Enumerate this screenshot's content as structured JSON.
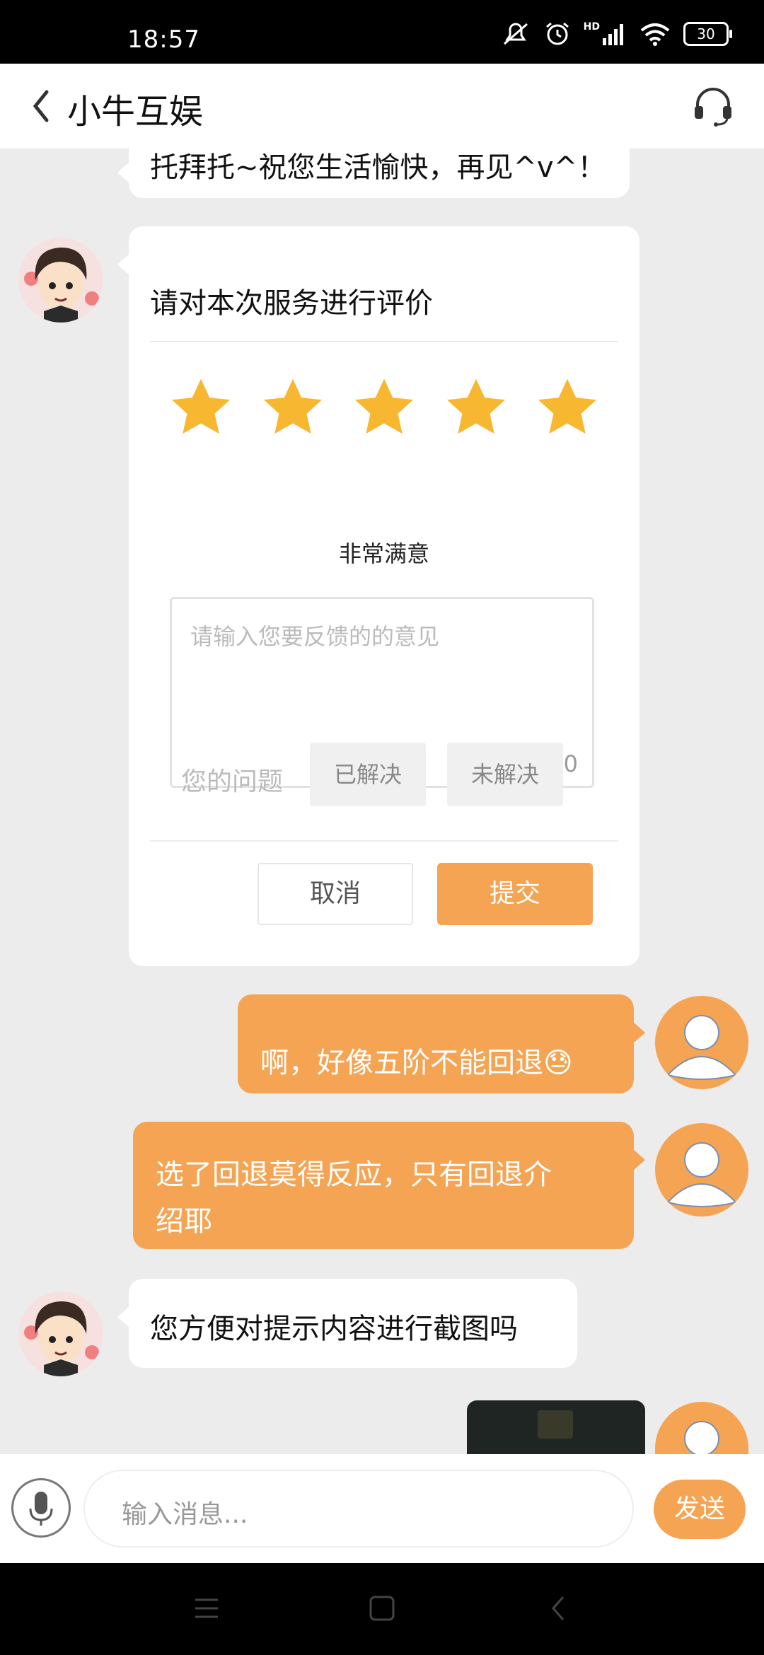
{
  "status_bar": {
    "time": "18:57",
    "network": "HD",
    "battery": "30"
  },
  "header": {
    "title": "小牛互娱",
    "back_icon": "chevron-left-icon",
    "support_icon": "headset-icon"
  },
  "messages": [
    {
      "side": "service",
      "text": "托拜托~祝您生活愉快，再见^v^！"
    },
    {
      "side": "user",
      "text": "啊，好像五阶不能回退😓"
    },
    {
      "side": "user",
      "text_line1": "选了回退莫得反应，只有回退介",
      "text_line2": "绍耶"
    },
    {
      "side": "service",
      "text": "您方便对提示内容进行截图吗"
    }
  ],
  "rating_card": {
    "title": "请对本次服务进行评价",
    "stars": 5,
    "max_stars": 5,
    "rating_label": "非常满意",
    "feedback_placeholder": "请输入您要反馈的的意见",
    "feedback_count": "0/200",
    "issue_label": "您的问题",
    "resolved_label": "已解决",
    "unresolved_label": "未解决",
    "cancel_label": "取消",
    "submit_label": "提交"
  },
  "input_bar": {
    "placeholder": "输入消息...",
    "send_label": "发送"
  },
  "colors": {
    "accent": "#f4a453",
    "star": "#f7b731",
    "background": "#ececec"
  }
}
